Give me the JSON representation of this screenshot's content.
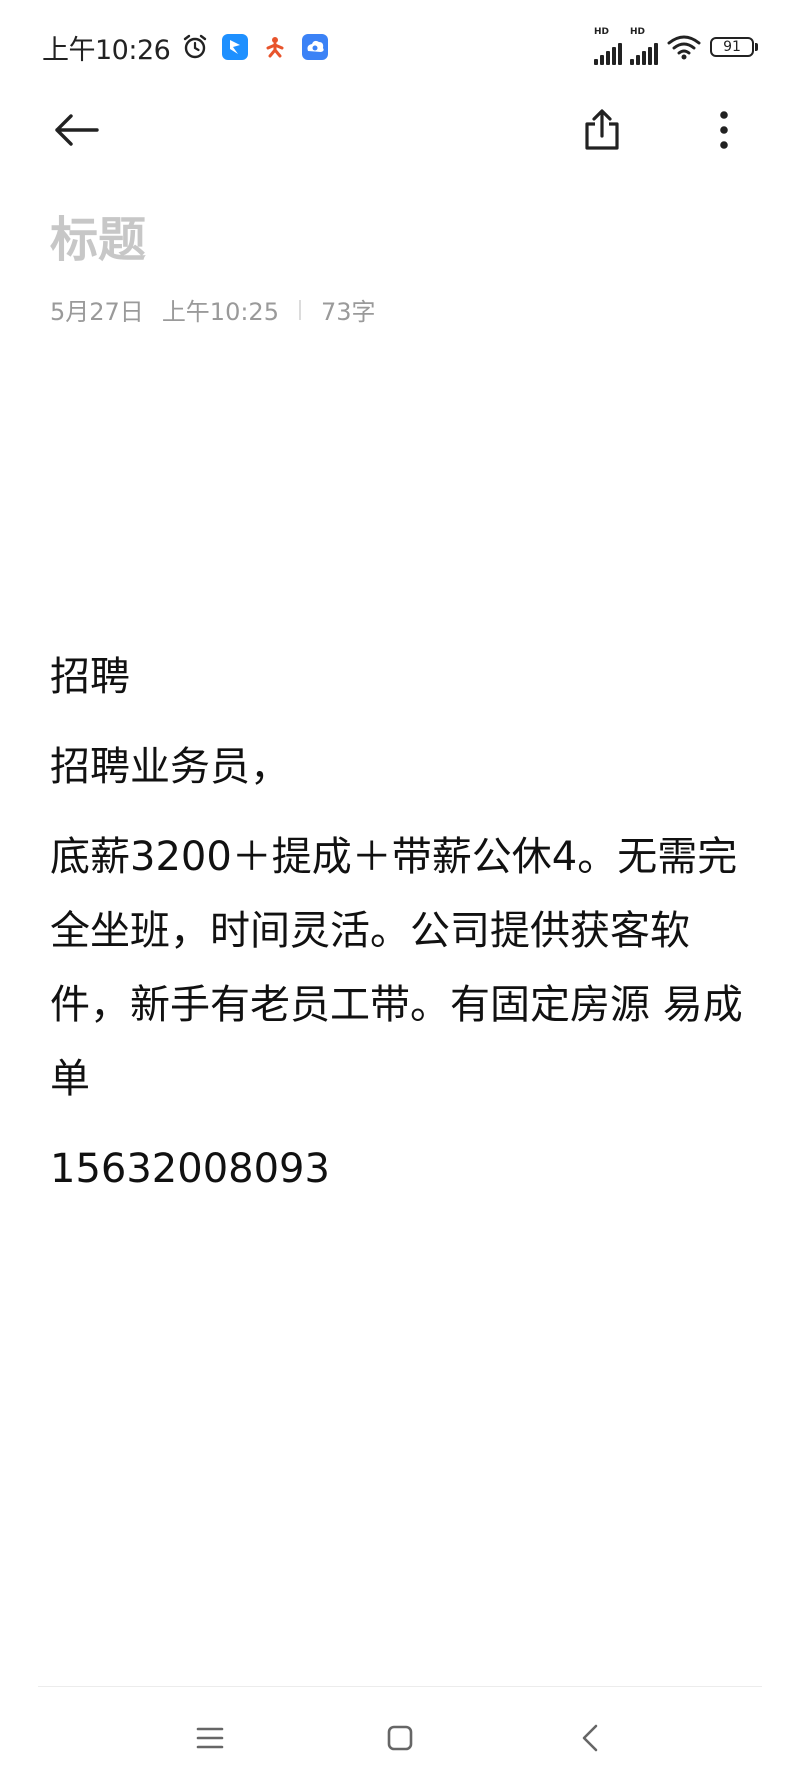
{
  "status_bar": {
    "time": "上午10:26",
    "signal_1_label": "HD",
    "signal_2_label": "HD",
    "battery_level": "91",
    "icons": [
      "alarm-icon",
      "blue-bird-app-icon",
      "red-figure-app-icon",
      "cloud-eye-app-icon",
      "signal-icon",
      "signal-icon",
      "wifi-icon",
      "battery-icon"
    ]
  },
  "toolbar": {
    "back_icon": "arrow-left-icon",
    "share_icon": "share-icon",
    "more_icon": "more-vertical-icon"
  },
  "note": {
    "title_placeholder": "标题",
    "date": "5月27日",
    "time": "上午10:25",
    "word_count": "73字",
    "paragraphs": [
      "招聘",
      "招聘业务员，",
      "底薪3200＋提成＋带薪公休4。无需完全坐班，时间灵活。公司提供获客软件，新手有老员工带。有固定房源 易成单",
      "15632008093"
    ]
  },
  "nav_bar": {
    "icons": [
      "menu-icon",
      "home-square-icon",
      "back-chevron-icon"
    ]
  },
  "colors": {
    "background": "#ffffff",
    "title_placeholder": "#c7c7c7",
    "meta_text": "#9a9a9a",
    "body_text": "#111111"
  }
}
